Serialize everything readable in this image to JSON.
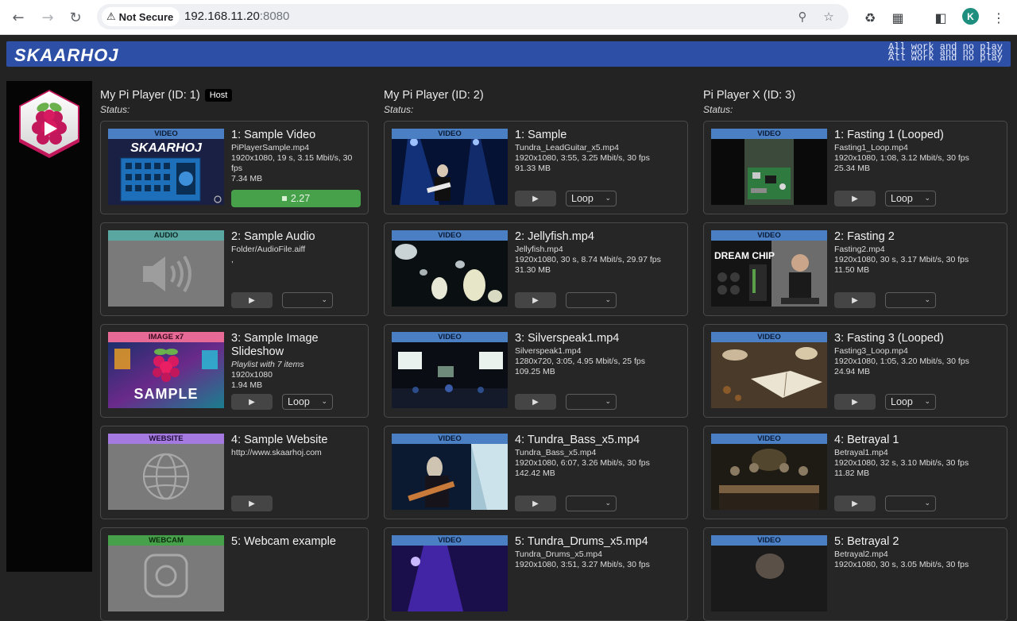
{
  "browser": {
    "not_secure": "Not Secure",
    "url_host": "192.168.11.20",
    "url_port": ":8080",
    "profile_initial": "K"
  },
  "banner": {
    "logo": "SKAARHOJ",
    "tagline": [
      "All work and no play",
      "All work and no play",
      "All work and no play"
    ],
    "color": "#2d4fa6"
  },
  "columns": [
    {
      "title": "My Pi Player (ID: 1)",
      "badge": "Host",
      "status_label": "Status:",
      "cards": [
        {
          "type_label": "VIDEO",
          "title": "1: Sample Video",
          "file": "PiPlayerSample.mp4",
          "meta": "1920x1080, 19 s, 3.15 Mbit/s, 30 fps",
          "size": "7.34 MB",
          "progress": "2.27",
          "thumb": "skaarhoj-panel"
        },
        {
          "type_label": "AUDIO",
          "title": "2: Sample Audio",
          "file": "Folder/AudioFile.aiff",
          "meta": ",",
          "loop": "",
          "thumb": "speaker-icon"
        },
        {
          "type_label": "IMAGE x7",
          "title": "3: Sample Image Slideshow",
          "file_italic": "Playlist with 7 items",
          "meta": "1920x1080",
          "size": "1.94 MB",
          "loop": "Loop",
          "thumb": "raspberry-sample",
          "thumb_text": "SAMPLE"
        },
        {
          "type_label": "WEBSITE",
          "title": "4: Sample Website",
          "file": "http://www.skaarhoj.com",
          "thumb": "globe-icon"
        },
        {
          "type_label": "WEBCAM",
          "title": "5: Webcam example",
          "thumb": "webcam-icon"
        }
      ]
    },
    {
      "title": "My Pi Player (ID: 2)",
      "status_label": "Status:",
      "cards": [
        {
          "type_label": "VIDEO",
          "title": "1: Sample",
          "file": "Tundra_LeadGuitar_x5.mp4",
          "meta": "1920x1080, 3:55, 3.25 Mbit/s, 30 fps",
          "size": "91.33 MB",
          "loop": "Loop",
          "thumb": "concert-guitar"
        },
        {
          "type_label": "VIDEO",
          "title": "2: Jellyfish.mp4",
          "file": "Jellyfish.mp4",
          "meta": "1920x1080, 30 s, 8.74 Mbit/s, 29.97 fps",
          "size": "31.30 MB",
          "loop": "",
          "thumb": "jellyfish"
        },
        {
          "type_label": "VIDEO",
          "title": "3: Silverspeak1.mp4",
          "file": "Silverspeak1.mp4",
          "meta": "1280x720, 3:05, 4.95 Mbit/s, 25 fps",
          "size": "109.25 MB",
          "loop": "",
          "thumb": "stage-screens"
        },
        {
          "type_label": "VIDEO",
          "title": "4: Tundra_Bass_x5.mp4",
          "file": "Tundra_Bass_x5.mp4",
          "meta": "1920x1080, 6:07, 3.26 Mbit/s, 30 fps",
          "size": "142.42 MB",
          "loop": "",
          "thumb": "bass-player"
        },
        {
          "type_label": "VIDEO",
          "title": "5: Tundra_Drums_x5.mp4",
          "file": "Tundra_Drums_x5.mp4",
          "meta": "1920x1080, 3:51, 3.27 Mbit/s, 30 fps",
          "thumb": "drums"
        }
      ]
    },
    {
      "title": "Pi Player X (ID: 3)",
      "status_label": "Status:",
      "cards": [
        {
          "type_label": "VIDEO",
          "title": "1: Fasting 1 (Looped)",
          "file": "Fasting1_Loop.mp4",
          "meta": "1920x1080, 1:08, 3.12 Mbit/s, 30 fps",
          "size": "25.34 MB",
          "loop": "Loop",
          "thumb": "circuit-board"
        },
        {
          "type_label": "VIDEO",
          "title": "2: Fasting 2",
          "file": "Fasting2.mp4",
          "meta": "1920x1080, 30 s, 3.17 Mbit/s, 30 fps",
          "size": "11.50 MB",
          "loop": "",
          "thumb": "dream-chip"
        },
        {
          "type_label": "VIDEO",
          "title": "3: Fasting 3 (Looped)",
          "file": "Fasting3_Loop.mp4",
          "meta": "1920x1080, 1:05, 3.20 Mbit/s, 30 fps",
          "size": "24.94 MB",
          "loop": "Loop",
          "thumb": "book-table"
        },
        {
          "type_label": "VIDEO",
          "title": "4: Betrayal 1",
          "file": "Betrayal1.mp4",
          "meta": "1920x1080, 32 s, 3.10 Mbit/s, 30 fps",
          "size": "11.82 MB",
          "loop": "",
          "thumb": "dinner-scene"
        },
        {
          "type_label": "VIDEO",
          "title": "5: Betrayal 2",
          "file": "Betrayal2.mp4",
          "meta": "1920x1080, 30 s, 3.05 Mbit/s, 30 fps",
          "thumb": "portrait-dark"
        }
      ]
    }
  ],
  "type_colors": {
    "VIDEO": "#4a7fc4",
    "AUDIO": "#5aa6a0",
    "IMAGE x7": "#e76a96",
    "WEBSITE": "#a57ae0",
    "WEBCAM": "#47a04a"
  },
  "progress_color": "#47a04a"
}
